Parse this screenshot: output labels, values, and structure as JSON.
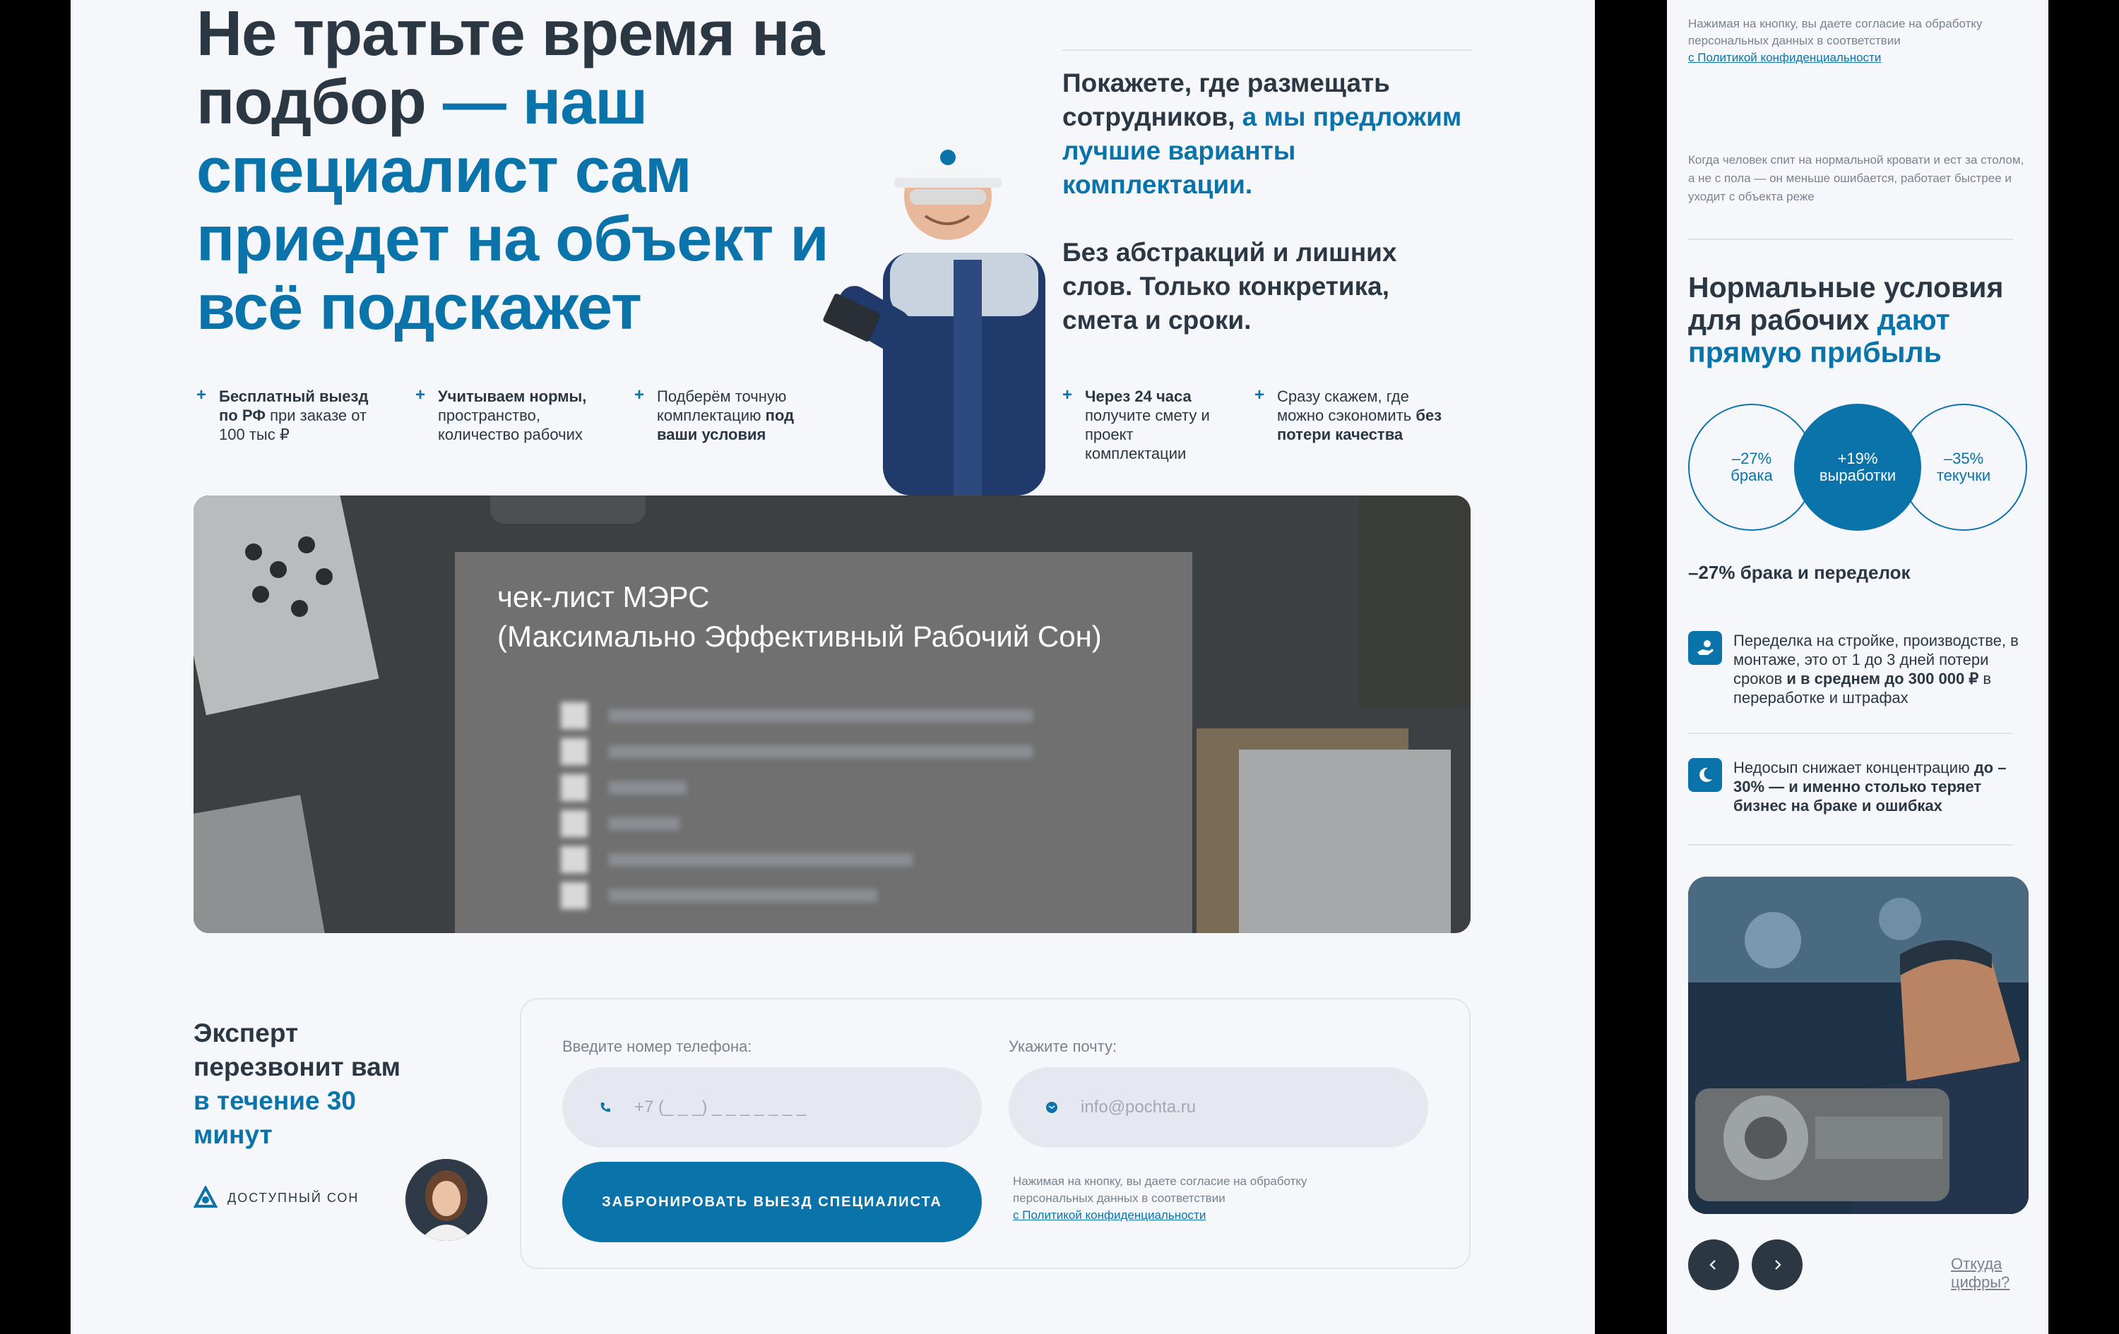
{
  "hero": {
    "title_dark": "Не тратьте время на подбор",
    "title_blue": "— наш специалист сам приедет на объект и всё подскажет"
  },
  "pitch": {
    "p1_dark": "Покажете, где размещать сотрудников,",
    "p1_blue": "а мы предложим лучшие варианты комплектации.",
    "p2": "Без абстракций и лишних слов. Только конкретика, смета и сроки."
  },
  "features": [
    {
      "bold": "Бесплатный выезд по РФ",
      "text": " при заказе от 100 тыс ₽"
    },
    {
      "bold": "Учитываем нормы,",
      "text": " пространство, количество рабочих"
    },
    {
      "text": "Подберём точную комплектацию ",
      "bold_end": "под ваши условия"
    },
    {
      "bold": "Через 24 часа",
      "text": " получите смету и проект комплектации"
    },
    {
      "text": "Сразу скажем, где можно сэкономить ",
      "bold_end": "без потери качества"
    }
  ],
  "banner": {
    "title_line1": "чек-лист МЭРС",
    "title_line2": "(Максимально Эффективный Рабочий Сон)"
  },
  "cta": {
    "dark": "Эксперт перезвонит вам",
    "blue": "в течение 30 минут",
    "brand": "ДОСТУПНЫЙ СОН"
  },
  "form": {
    "phone_label": "Введите номер телефона:",
    "phone_placeholder": "+7 (_ _ _) _ _ _ _ _ _ _",
    "email_label": "Укажите почту:",
    "email_placeholder": "info@pochta.ru",
    "submit": "ЗАБРОНИРОВАТЬ ВЫЕЗД СПЕЦИАЛИСТА",
    "consent": "Нажимая на кнопку, вы даете согласие на обработку персональных данных в соответствии",
    "consent_link": "с Политикой конфиденциальности"
  },
  "side": {
    "consent": "Нажимая на кнопку, вы даете согласие на обработку персональных данных в соответствии",
    "consent_link": "с Политикой конфиденциальности",
    "quote": "Когда человек спит на нормальной кровати и ест за столом, а не с пола — он меньше ошибается, работает быстрее и уходит с объекта реже",
    "title_dark": "Нормальные условия для рабочих",
    "title_blue": "дают прямую прибыль",
    "circles": [
      {
        "value": "–27%",
        "label": "брака"
      },
      {
        "value": "+19%",
        "label": "выработки"
      },
      {
        "value": "–35%",
        "label": "текучки"
      }
    ],
    "stat": "–27% брака и переделок",
    "item1_text": "Переделка на стройке, производстве, в монтаже, это от 1 до 3 дней потери сроков ",
    "item1_bold": "и в среднем до 300 000 ₽",
    "item1_tail": " в переработке и штрафах",
    "item2_text": "Недосып снижает концентрацию ",
    "item2_bold": "до –30% — и именно столько теряет бизнес на браке и ошибках",
    "source_link": "Откуда цифры?"
  },
  "colors": {
    "accent": "#0a74aa",
    "dark": "#2c3744",
    "muted": "#7a8290"
  }
}
